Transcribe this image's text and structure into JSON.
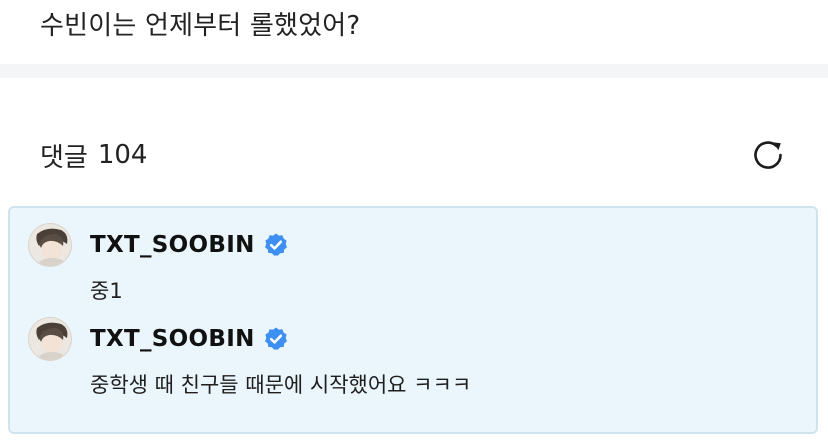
{
  "question": {
    "text": "수빈이는 언제부터 롤했었어?"
  },
  "comments_section": {
    "label": "댓글",
    "count": "104"
  },
  "comments": [
    {
      "author": "TXT_SOOBIN",
      "verified": true,
      "text": "중1"
    },
    {
      "author": "TXT_SOOBIN",
      "verified": true,
      "text": "중학생 때 친구들 때문에 시작했어요 ㅋㅋㅋ"
    }
  ],
  "colors": {
    "highlight_background": "#eaf6fc",
    "highlight_border": "#cfe3ef",
    "verified_badge": "#3d8ff2",
    "divider": "#f4f5f7"
  },
  "icons": {
    "refresh": "refresh-icon",
    "verified": "verified-badge-icon"
  }
}
